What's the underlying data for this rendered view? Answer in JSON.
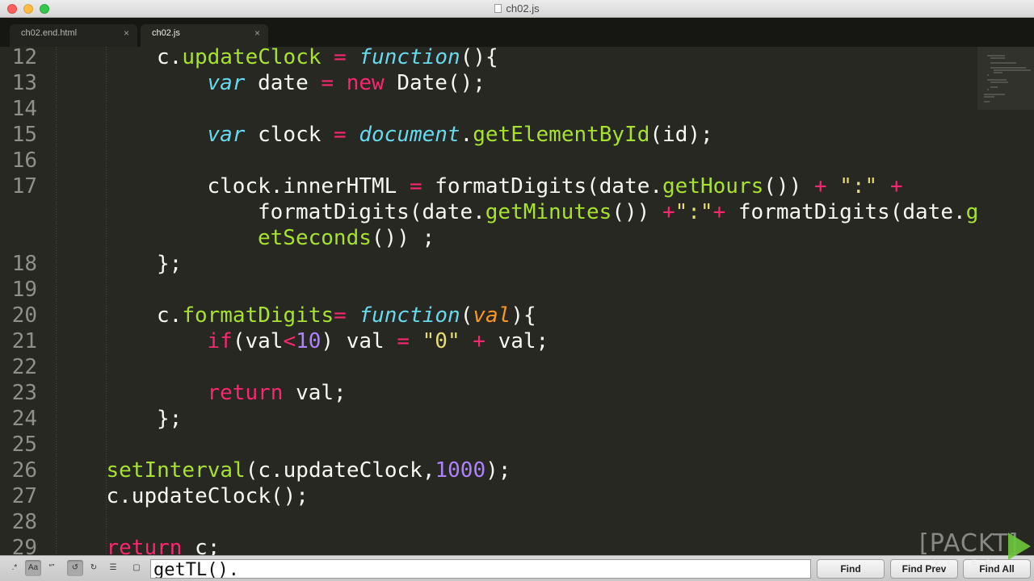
{
  "window": {
    "title": "ch02.js"
  },
  "tabs": [
    {
      "label": "ch02.end.html",
      "close": "×",
      "active": false
    },
    {
      "label": "ch02.js",
      "close": "×",
      "active": true
    }
  ],
  "editor": {
    "lines": [
      {
        "num": "12",
        "indent": 2,
        "tokens": [
          [
            "",
            "c"
          ],
          [
            "",
            "."
          ],
          [
            "fn",
            "updateClock"
          ],
          [
            "",
            " "
          ],
          [
            "kw",
            "="
          ],
          [
            "",
            " "
          ],
          [
            "sf",
            "function"
          ],
          [
            "",
            "(){"
          ]
        ]
      },
      {
        "num": "13",
        "indent": 3,
        "tokens": [
          [
            "sf",
            "var"
          ],
          [
            "",
            " date "
          ],
          [
            "kw",
            "="
          ],
          [
            "",
            " "
          ],
          [
            "kw",
            "new"
          ],
          [
            "",
            " Date();"
          ]
        ]
      },
      {
        "num": "14",
        "indent": 0,
        "tokens": []
      },
      {
        "num": "15",
        "indent": 3,
        "tokens": [
          [
            "sf",
            "var"
          ],
          [
            "",
            " clock "
          ],
          [
            "kw",
            "="
          ],
          [
            "",
            " "
          ],
          [
            "sf",
            "document"
          ],
          [
            "",
            "."
          ],
          [
            "fn",
            "getElementById"
          ],
          [
            "",
            "(id);"
          ]
        ]
      },
      {
        "num": "16",
        "indent": 0,
        "tokens": []
      },
      {
        "num": "17",
        "indent": 3,
        "tokens": [
          [
            "",
            "clock.innerHTML "
          ],
          [
            "kw",
            "="
          ],
          [
            "",
            " formatDigits(date."
          ],
          [
            "fn",
            "getHours"
          ],
          [
            "",
            "()) "
          ],
          [
            "kw",
            "+"
          ],
          [
            "",
            " "
          ],
          [
            "str",
            "\":\""
          ],
          [
            "",
            " "
          ],
          [
            "kw",
            "+"
          ]
        ]
      },
      {
        "num": "",
        "indent": 4,
        "tokens": [
          [
            "",
            "formatDigits(date."
          ],
          [
            "fn",
            "getMinutes"
          ],
          [
            "",
            "()) "
          ],
          [
            "kw",
            "+"
          ],
          [
            "str",
            "\":\""
          ],
          [
            "kw",
            "+"
          ],
          [
            "",
            " formatDigits(date."
          ],
          [
            "fn",
            "g"
          ]
        ]
      },
      {
        "num": "",
        "indent": 4,
        "tokens": [
          [
            "fn",
            "etSeconds"
          ],
          [
            "",
            "()) ;"
          ]
        ]
      },
      {
        "num": "18",
        "indent": 2,
        "tokens": [
          [
            "",
            "};"
          ]
        ]
      },
      {
        "num": "19",
        "indent": 0,
        "tokens": []
      },
      {
        "num": "20",
        "indent": 2,
        "tokens": [
          [
            "",
            "c."
          ],
          [
            "fn",
            "formatDigits"
          ],
          [
            "kw",
            "="
          ],
          [
            "",
            " "
          ],
          [
            "sf",
            "function"
          ],
          [
            "",
            "("
          ],
          [
            "prm",
            "val"
          ],
          [
            "",
            "){"
          ]
        ]
      },
      {
        "num": "21",
        "indent": 3,
        "tokens": [
          [
            "kw",
            "if"
          ],
          [
            "",
            "(val"
          ],
          [
            "kw",
            "<"
          ],
          [
            "num",
            "10"
          ],
          [
            "",
            ") val "
          ],
          [
            "kw",
            "="
          ],
          [
            "",
            " "
          ],
          [
            "str",
            "\"0\""
          ],
          [
            "",
            " "
          ],
          [
            "kw",
            "+"
          ],
          [
            "",
            " val;"
          ]
        ]
      },
      {
        "num": "22",
        "indent": 0,
        "tokens": []
      },
      {
        "num": "23",
        "indent": 3,
        "tokens": [
          [
            "kw",
            "return"
          ],
          [
            "",
            " val;"
          ]
        ]
      },
      {
        "num": "24",
        "indent": 2,
        "tokens": [
          [
            "",
            "};"
          ]
        ]
      },
      {
        "num": "25",
        "indent": 0,
        "tokens": []
      },
      {
        "num": "26",
        "indent": 1,
        "tokens": [
          [
            "fn",
            "setInterval"
          ],
          [
            "",
            "(c.updateClock,"
          ],
          [
            "num",
            "1000"
          ],
          [
            "",
            ");"
          ]
        ]
      },
      {
        "num": "27",
        "indent": 1,
        "tokens": [
          [
            "",
            "c.updateClock();"
          ]
        ]
      },
      {
        "num": "28",
        "indent": 0,
        "tokens": []
      },
      {
        "num": "29",
        "indent": 1,
        "tokens": [
          [
            "kw",
            "return"
          ],
          [
            "",
            " c;"
          ]
        ]
      }
    ]
  },
  "find_panel": {
    "options": [
      {
        "name": "regex-toggle",
        "glyph": ".*",
        "on": false
      },
      {
        "name": "case-sensitive-toggle",
        "glyph": "Aa",
        "on": true
      },
      {
        "name": "whole-word-toggle",
        "glyph": "“”",
        "on": false
      },
      {
        "name": "wrap-toggle",
        "glyph": "↺",
        "on": true
      },
      {
        "name": "in-selection-toggle",
        "glyph": "↻",
        "on": false
      },
      {
        "name": "highlight-matches-toggle",
        "glyph": "☰",
        "on": false
      },
      {
        "name": "show-context-toggle",
        "glyph": "▢",
        "on": false
      }
    ],
    "query": "getTL().",
    "find_label": "Find",
    "find_prev_label": "Find Prev",
    "find_all_label": "Find All"
  },
  "watermark": {
    "brand": "[PACKT]",
    "sub": "VIDEO"
  },
  "colors": {
    "background": "#272822",
    "keyword": "#f92672",
    "storage": "#66d9ef",
    "function": "#a6e22e",
    "string": "#e6db74",
    "number": "#ae81ff",
    "parameter": "#fd971f"
  }
}
